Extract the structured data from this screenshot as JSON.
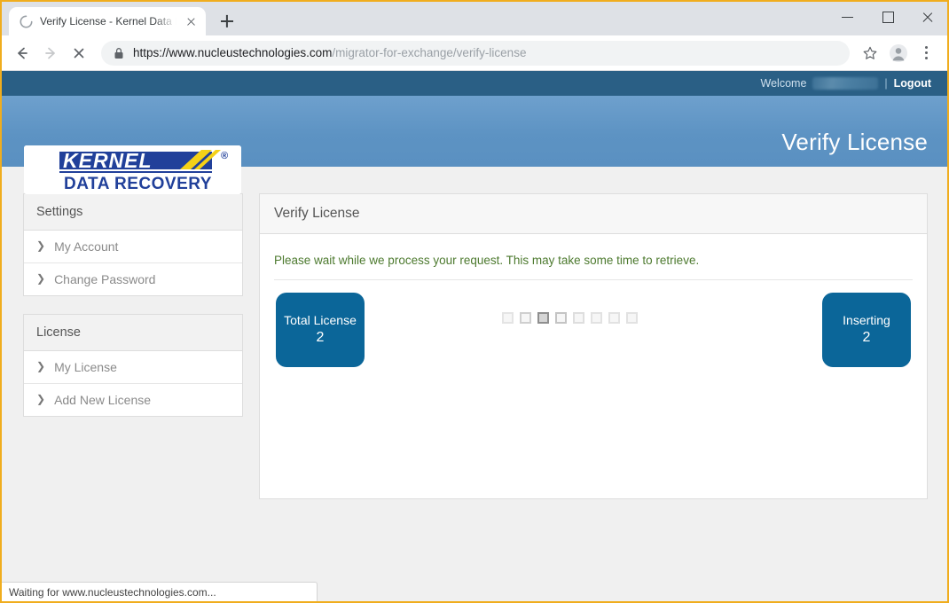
{
  "browser": {
    "tab": {
      "title": "Verify License - Kernel Data Reco",
      "spinner_icon": "loading-spinner-icon",
      "close_icon": "close-icon"
    },
    "new_tab_icon": "plus-icon",
    "window_controls": {
      "minimize_icon": "minimize-icon",
      "maximize_icon": "maximize-icon",
      "close_icon": "close-icon"
    },
    "nav": {
      "back_icon": "back-arrow-icon",
      "forward_icon": "forward-arrow-icon",
      "stop_icon": "stop-loading-icon"
    },
    "omnibox": {
      "lock_icon": "lock-icon",
      "url_scheme_host": "https://www.nucleustechnologies.com",
      "url_path": "/migrator-for-exchange/verify-license",
      "full_url": "https://www.nucleustechnologies.com/migrator-for-exchange/verify-license"
    },
    "toolbar_icons": {
      "bookmark_icon": "star-icon",
      "profile_icon": "account-avatar-icon",
      "menu_icon": "three-dot-menu-icon"
    },
    "status_text": "Waiting for www.nucleustechnologies.com..."
  },
  "site": {
    "topbar": {
      "welcome_label": "Welcome",
      "username_redacted": "",
      "separator": "|",
      "logout_label": "Logout"
    },
    "logo": {
      "primary_text": "KERNEL",
      "secondary_text": "DATA RECOVERY",
      "trademark": "®"
    },
    "page_title": "Verify License"
  },
  "sidebar": {
    "groups": [
      {
        "title": "Settings",
        "items": [
          {
            "label": "My Account",
            "icon": "chevron-right-icon"
          },
          {
            "label": "Change Password",
            "icon": "chevron-right-icon"
          }
        ]
      },
      {
        "title": "License",
        "items": [
          {
            "label": "My License",
            "icon": "chevron-right-icon"
          },
          {
            "label": "Add New License",
            "icon": "chevron-right-icon"
          }
        ]
      }
    ]
  },
  "main": {
    "panel_title": "Verify License",
    "notice": "Please wait while we process your request. This may take some time to retrieve.",
    "badges": [
      {
        "label": "Total License",
        "value": "2"
      },
      {
        "label": "Inserting",
        "value": "2"
      }
    ],
    "loader": {
      "icon": "loading-squares-icon",
      "square_count": 8,
      "active_index": 2
    }
  },
  "colors": {
    "window_border": "#f0ad1e",
    "topbar_blue": "#2a5f85",
    "header_blue": "#5d93c3",
    "badge_blue": "#0b6699",
    "notice_green": "#4d7a2f",
    "page_background": "#f0f0f0",
    "logo_navy": "#21409a",
    "logo_yellow": "#f5d117"
  }
}
